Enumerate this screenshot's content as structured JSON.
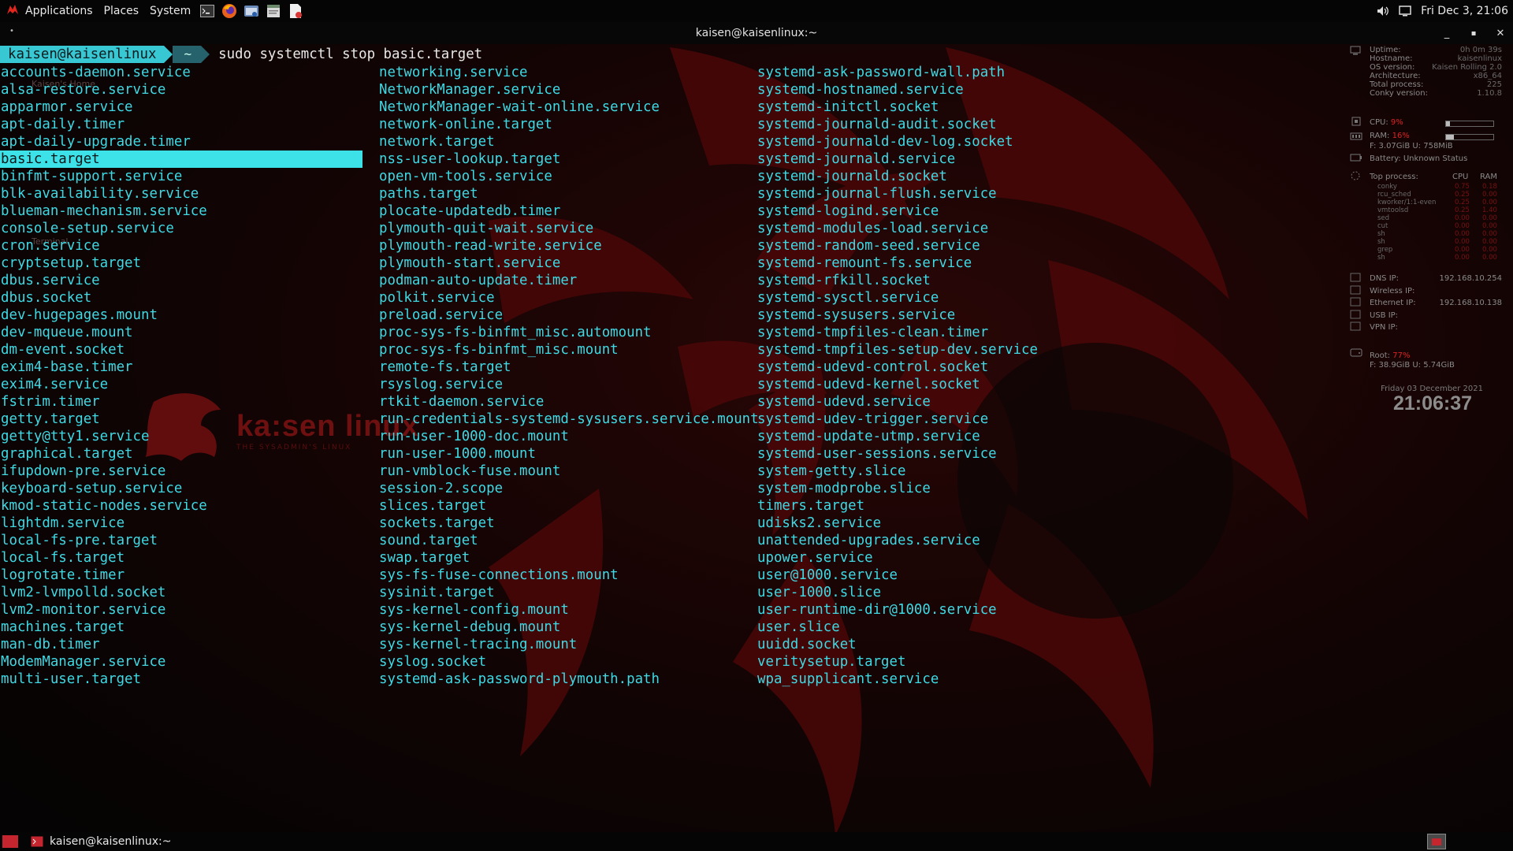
{
  "top_panel": {
    "menus": [
      "Applications",
      "Places",
      "System"
    ],
    "launchers": [
      "terminal-icon",
      "firefox-icon",
      "file-manager-icon",
      "text-editor-icon",
      "document-icon"
    ],
    "clock": "Fri Dec 3, 21:06"
  },
  "window": {
    "title": "kaisen@kaisenlinux:~"
  },
  "terminal": {
    "prompt_user": "kaisen@kaisenlinux",
    "prompt_dir": "~",
    "command": "sudo systemctl stop basic.target",
    "selected_item": "basic.target",
    "columns": [
      [
        "accounts-daemon.service",
        "alsa-restore.service",
        "apparmor.service",
        "apt-daily.timer",
        "apt-daily-upgrade.timer",
        "basic.target",
        "binfmt-support.service",
        "blk-availability.service",
        "blueman-mechanism.service",
        "console-setup.service",
        "cron.service",
        "cryptsetup.target",
        "dbus.service",
        "dbus.socket",
        "dev-hugepages.mount",
        "dev-mqueue.mount",
        "dm-event.socket",
        "exim4-base.timer",
        "exim4.service",
        "fstrim.timer",
        "getty.target",
        "getty@tty1.service",
        "graphical.target",
        "ifupdown-pre.service",
        "keyboard-setup.service",
        "kmod-static-nodes.service",
        "lightdm.service",
        "local-fs-pre.target",
        "local-fs.target",
        "logrotate.timer",
        "lvm2-lvmpolld.socket",
        "lvm2-monitor.service",
        "machines.target",
        "man-db.timer",
        "ModemManager.service",
        "multi-user.target"
      ],
      [
        "networking.service",
        "NetworkManager.service",
        "NetworkManager-wait-online.service",
        "network-online.target",
        "network.target",
        "nss-user-lookup.target",
        "open-vm-tools.service",
        "paths.target",
        "plocate-updatedb.timer",
        "plymouth-quit-wait.service",
        "plymouth-read-write.service",
        "plymouth-start.service",
        "podman-auto-update.timer",
        "polkit.service",
        "preload.service",
        "proc-sys-fs-binfmt_misc.automount",
        "proc-sys-fs-binfmt_misc.mount",
        "remote-fs.target",
        "rsyslog.service",
        "rtkit-daemon.service",
        "run-credentials-systemd-sysusers.service.mount",
        "run-user-1000-doc.mount",
        "run-user-1000.mount",
        "run-vmblock-fuse.mount",
        "session-2.scope",
        "slices.target",
        "sockets.target",
        "sound.target",
        "swap.target",
        "sys-fs-fuse-connections.mount",
        "sysinit.target",
        "sys-kernel-config.mount",
        "sys-kernel-debug.mount",
        "sys-kernel-tracing.mount",
        "syslog.socket",
        "systemd-ask-password-plymouth.path"
      ],
      [
        "systemd-ask-password-wall.path",
        "systemd-hostnamed.service",
        "systemd-initctl.socket",
        "systemd-journald-audit.socket",
        "systemd-journald-dev-log.socket",
        "systemd-journald.service",
        "systemd-journald.socket",
        "systemd-journal-flush.service",
        "systemd-logind.service",
        "systemd-modules-load.service",
        "systemd-random-seed.service",
        "systemd-remount-fs.service",
        "systemd-rfkill.socket",
        "systemd-sysctl.service",
        "systemd-sysusers.service",
        "systemd-tmpfiles-clean.timer",
        "systemd-tmpfiles-setup-dev.service",
        "systemd-udevd-control.socket",
        "systemd-udevd-kernel.socket",
        "systemd-udevd.service",
        "systemd-udev-trigger.service",
        "systemd-update-utmp.service",
        "systemd-user-sessions.service",
        "system-getty.slice",
        "system-modprobe.slice",
        "timers.target",
        "udisks2.service",
        "unattended-upgrades.service",
        "upower.service",
        "user@1000.service",
        "user-1000.slice",
        "user-runtime-dir@1000.service",
        "user.slice",
        "uuidd.socket",
        "veritysetup.target",
        "wpa_supplicant.service"
      ]
    ]
  },
  "desktop": {
    "icon_labels": [
      "Kaisen's Home",
      "Terminal"
    ],
    "logo_text": "ka:sen linux",
    "logo_tagline": "THE SYSADMIN'S LINUX"
  },
  "conky": {
    "system_rows": [
      {
        "k": "Uptime:",
        "v": "0h 0m 39s"
      },
      {
        "k": "Hostname:",
        "v": "kaisenlinux"
      },
      {
        "k": "OS version:",
        "v": "Kaisen Rolling 2.0"
      },
      {
        "k": "Architecture:",
        "v": "x86_64"
      },
      {
        "k": "Total process:",
        "v": "225"
      },
      {
        "k": "Conky version:",
        "v": "1.10.8"
      }
    ],
    "cpu": {
      "label": "CPU:",
      "value": "9%",
      "level": 0.09
    },
    "ram": {
      "label": "RAM:",
      "value": "16%",
      "level": 0.16
    },
    "ram_detail": "F: 3.07GiB U: 758MiB",
    "battery": "Battery: Unknown Status",
    "top_header": {
      "title": "Top process:",
      "cpu": "CPU",
      "ram": "RAM"
    },
    "processes": [
      {
        "name": "conky",
        "cpu": "0.75",
        "ram": "0.18"
      },
      {
        "name": "rcu_sched",
        "cpu": "0.25",
        "ram": "0.00"
      },
      {
        "name": "kworker/1:1-even",
        "cpu": "0.25",
        "ram": "0.00"
      },
      {
        "name": "vmtoolsd",
        "cpu": "0.25",
        "ram": "1.40"
      },
      {
        "name": "sed",
        "cpu": "0.00",
        "ram": "0.00"
      },
      {
        "name": "cut",
        "cpu": "0.00",
        "ram": "0.00"
      },
      {
        "name": "sh",
        "cpu": "0.00",
        "ram": "0.00"
      },
      {
        "name": "sh",
        "cpu": "0.00",
        "ram": "0.00"
      },
      {
        "name": "grep",
        "cpu": "0.00",
        "ram": "0.00"
      },
      {
        "name": "sh",
        "cpu": "0.00",
        "ram": "0.00"
      }
    ],
    "network": [
      {
        "k": "DNS IP:",
        "v": "192.168.10.254"
      },
      {
        "k": "Wireless IP:",
        "v": ""
      },
      {
        "k": "Ethernet IP:",
        "v": "192.168.10.138"
      },
      {
        "k": "USB IP:",
        "v": ""
      },
      {
        "k": "VPN IP:",
        "v": ""
      }
    ],
    "root": {
      "label": "Root:",
      "value": "77%"
    },
    "root_detail": "F: 38.9GiB U: 5.74GiB",
    "date": "Friday 03 December 2021",
    "time": "21:06:37"
  },
  "bottom_panel": {
    "task_label": "kaisen@kaisenlinux:~"
  },
  "colors": {
    "accent": "#3de1e8",
    "wallpaper_red": "#5a0a0a",
    "brand_red": "#e0261d"
  }
}
